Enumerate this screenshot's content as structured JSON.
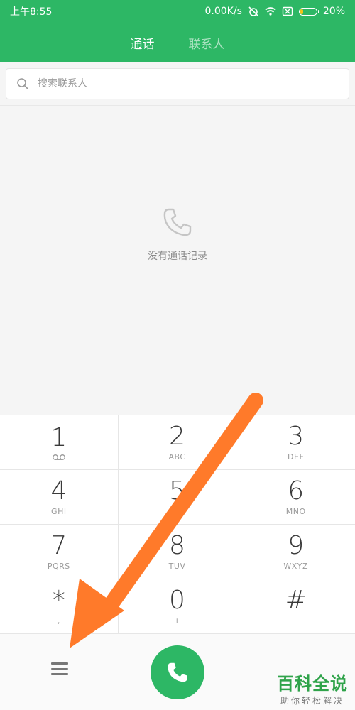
{
  "status_bar": {
    "time": "上午8:55",
    "speed": "0.00K/s",
    "battery_percent": "20%",
    "battery_level": 0.2
  },
  "tabs": [
    {
      "label": "通话",
      "active": true
    },
    {
      "label": "联系人",
      "active": false
    }
  ],
  "search": {
    "placeholder": "搜索联系人"
  },
  "empty_state": {
    "text": "没有通话记录",
    "icon": "phone-outline-icon"
  },
  "keypad": [
    {
      "digit": "1",
      "letters": "",
      "sub_icon": "voicemail-icon"
    },
    {
      "digit": "2",
      "letters": "ABC"
    },
    {
      "digit": "3",
      "letters": "DEF"
    },
    {
      "digit": "4",
      "letters": "GHI"
    },
    {
      "digit": "5",
      "letters": "JKL"
    },
    {
      "digit": "6",
      "letters": "MNO"
    },
    {
      "digit": "7",
      "letters": "PQRS"
    },
    {
      "digit": "8",
      "letters": "TUV"
    },
    {
      "digit": "9",
      "letters": "WXYZ"
    },
    {
      "digit": "*",
      "letters": ","
    },
    {
      "digit": "0",
      "letters": "+"
    },
    {
      "digit": "#",
      "letters": ""
    }
  ],
  "bottom": {
    "menu_icon": "menu-icon",
    "call_icon": "phone-icon"
  },
  "watermark": {
    "title": "百科全说",
    "subtitle": "助你轻松解决"
  },
  "colors": {
    "accent": "#2db765",
    "arrow": "#ff7a2a"
  }
}
